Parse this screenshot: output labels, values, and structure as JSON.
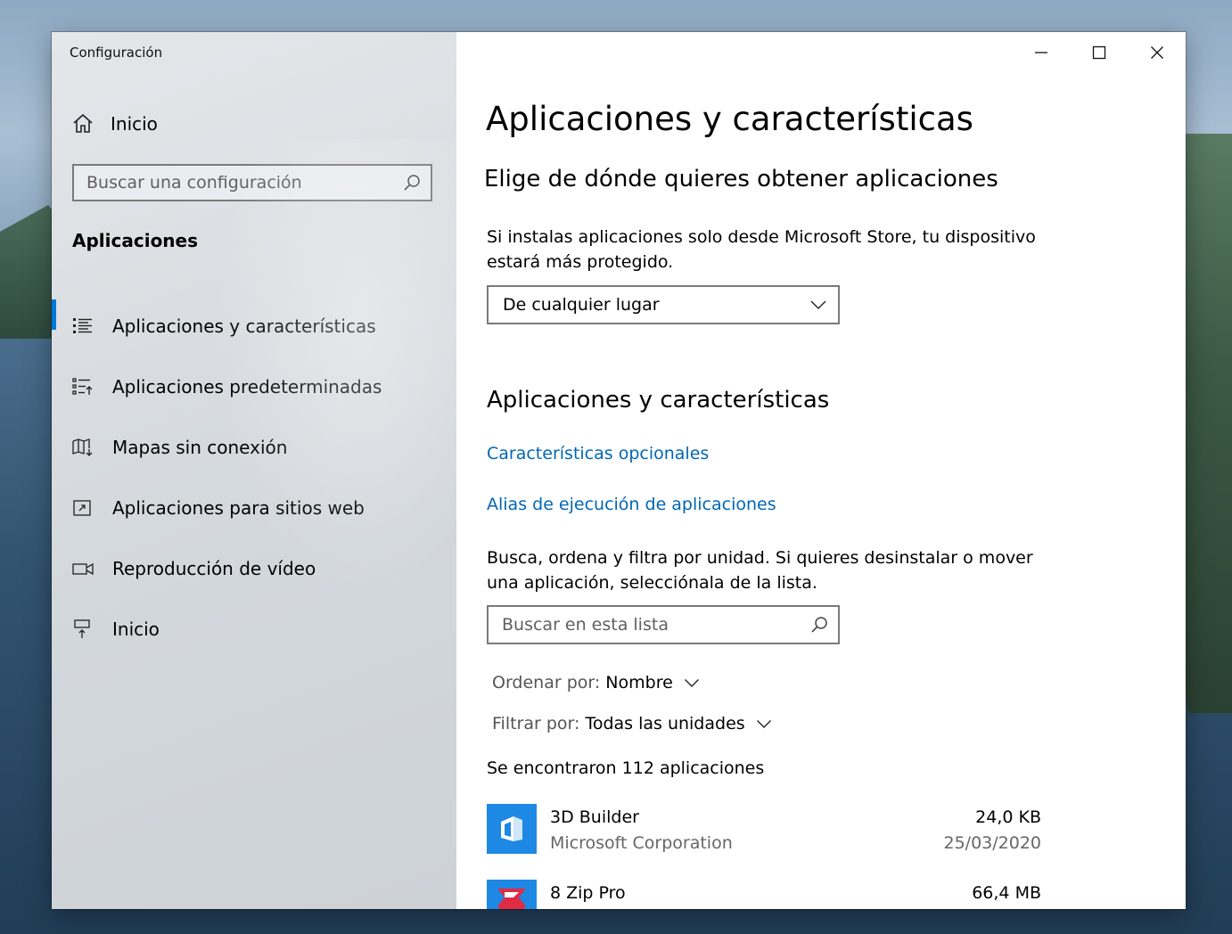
{
  "window": {
    "title": "Configuración"
  },
  "sidebar": {
    "home_label": "Inicio",
    "search_placeholder": "Buscar una configuración",
    "section_label": "Aplicaciones",
    "items": [
      {
        "label": "Aplicaciones y características",
        "icon": "list-icon",
        "active": true
      },
      {
        "label": "Aplicaciones predeterminadas",
        "icon": "default-apps-icon",
        "active": false
      },
      {
        "label": "Mapas sin conexión",
        "icon": "offline-maps-icon",
        "active": false
      },
      {
        "label": "Aplicaciones para sitios web",
        "icon": "apps-for-websites-icon",
        "active": false
      },
      {
        "label": "Reproducción de vídeo",
        "icon": "video-icon",
        "active": false
      },
      {
        "label": "Inicio",
        "icon": "startup-icon",
        "active": false
      }
    ]
  },
  "main": {
    "title": "Aplicaciones y características",
    "choose_heading": "Elige de dónde quieres obtener aplicaciones",
    "choose_desc": "Si instalas aplicaciones solo desde Microsoft Store, tu dispositivo estará más protegido.",
    "source_selected": "De cualquier lugar",
    "apps_heading": "Aplicaciones y características",
    "link_optional": "Características opcionales",
    "link_alias": "Alias de ejecución de aplicaciones",
    "list_desc": "Busca, ordena y filtra por unidad. Si quieres desinstalar o mover una aplicación, selecciónala de la lista.",
    "list_search_placeholder": "Buscar en esta lista",
    "sort_key": "Ordenar por:",
    "sort_value": "Nombre",
    "filter_key": "Filtrar por:",
    "filter_value": "Todas las unidades",
    "count_text": "Se encontraron 112 aplicaciones",
    "apps": [
      {
        "name": "3D Builder",
        "publisher": "Microsoft Corporation",
        "size": "24,0 KB",
        "date": "25/03/2020",
        "tile_color": "#1e88e5"
      },
      {
        "name": "8 Zip Pro",
        "publisher": "",
        "size": "66,4 MB",
        "date": "",
        "tile_color": "#1e88e5"
      }
    ]
  },
  "colors": {
    "accent": "#0078d7",
    "link": "#0066b4"
  }
}
